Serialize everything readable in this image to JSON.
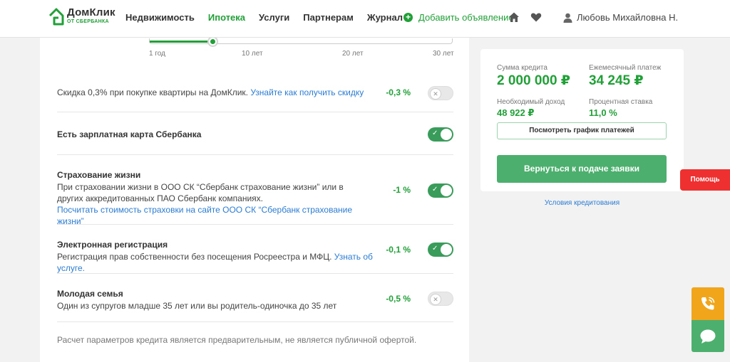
{
  "header": {
    "logo_title": "ДомКлик",
    "logo_sub": "ОТ СБЕРБАНКА",
    "nav": [
      "Недвижимость",
      "Ипотека",
      "Услуги",
      "Партнерам",
      "Журнал"
    ],
    "add_ad": "Добавить объявление",
    "user_name": "Любовь Михайловна Н."
  },
  "slider": {
    "ticks": [
      "1 год",
      "10 лет",
      "20 лет",
      "30 лет"
    ]
  },
  "options": [
    {
      "title": "",
      "text": "Скидка 0,3% при покупке квартиры на ДомКлик.",
      "link": "Узнайте как получить скидку",
      "pct": "-0,3 %",
      "on": false
    },
    {
      "title": "Есть зарплатная карта Сбербанка",
      "text": "",
      "link": "",
      "pct": "",
      "on": true
    },
    {
      "title": "Страхование жизни",
      "text": "При страховании жизни в ООО СК “Сбербанк страхование жизни” или в других аккредитованных ПАО Сбербанк компаниях.",
      "link": "Посчитать стоимость страховки на сайте ООО СК “Сбербанк страхование жизни”",
      "pct": "-1 %",
      "on": true
    },
    {
      "title": "Электронная регистрация",
      "text": "Регистрация прав собственности без посещения Росреестра и МФЦ.",
      "link": "Узнать об услуге.",
      "pct": "-0,1 %",
      "on": true
    },
    {
      "title": "Молодая семья",
      "text": "Один из супругов младше 35 лет или вы родитель-одиночка до 35 лет",
      "link": "",
      "pct": "-0,5 %",
      "on": false
    }
  ],
  "disclaimer": "Расчет параметров кредита является предварительным, не является публичной офертой.",
  "summary": {
    "loan_label": "Сумма кредита",
    "loan_value": "2 000 000 ₽",
    "payment_label": "Ежемесячный платеж",
    "payment_value": "34 245 ₽",
    "income_label": "Необходимый доход",
    "income_value": "48 922 ₽",
    "rate_label": "Процентная ставка",
    "rate_value": "11,0 %",
    "schedule_button": "Посмотреть график платежей",
    "return_button": "Вернуться к подаче заявки",
    "terms_link": "Условия кредитования"
  },
  "help_button": "Помощь",
  "colors": {
    "brand_green": "#21a038",
    "button_green": "#4caf6e",
    "help_red": "#ef3030",
    "call_orange": "#f0a51a",
    "link_blue": "#2b7cd3"
  }
}
